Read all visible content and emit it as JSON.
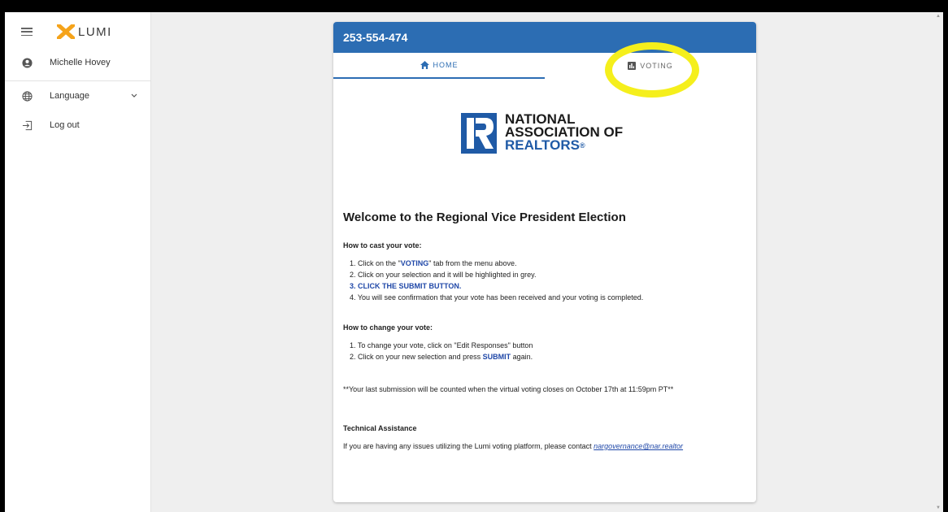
{
  "sidebar": {
    "logo_text": "LUMI",
    "user_name": "Michelle Hovey",
    "language_label": "Language",
    "logout_label": "Log out"
  },
  "card": {
    "meeting_id": "253-554-474",
    "tabs": [
      {
        "label": "HOME",
        "icon": "home-icon",
        "active": true
      },
      {
        "label": "VOTING",
        "icon": "bar-chart-icon",
        "active": false
      }
    ]
  },
  "logo": {
    "line1": "NATIONAL",
    "line2": "ASSOCIATION OF",
    "line3": "REALTORS",
    "reg": "®"
  },
  "content": {
    "welcome": "Welcome to the Regional Vice President Election",
    "cast_heading": "How to cast your vote:",
    "cast_steps": {
      "s1_pre": "1. Click on the \"",
      "s1_hl": "VOTING",
      "s1_post": "\" tab from the menu above.",
      "s2": "2. Click on your selection and it will be highlighted in grey.",
      "s3_num": "3. ",
      "s3_hl": "CLICK THE SUBMIT BUTTON.",
      "s4": "4. You will see confirmation that your vote has been received and your voting is completed."
    },
    "change_heading": "How to change your vote:",
    "change_steps": {
      "s1": "1. To change your vote, click on \"Edit Responses\" button",
      "s2_pre": "2. Click on your new selection and press ",
      "s2_hl": "SUBMIT",
      "s2_post": " again."
    },
    "note": "**Your last submission will be counted when the virtual voting closes on October 17th at 11:59pm PT**",
    "tech_heading": "Technical Assistance",
    "assist_text": "If you are having any issues utilizing the Lumi voting platform, please contact ",
    "assist_email": "nargovernance@nar.realtor"
  },
  "colors": {
    "header_blue": "#2c6db3",
    "accent_blue": "#2048a8",
    "lumi_orange": "#f5a31a",
    "highlight_yellow": "#f5ef1c"
  }
}
